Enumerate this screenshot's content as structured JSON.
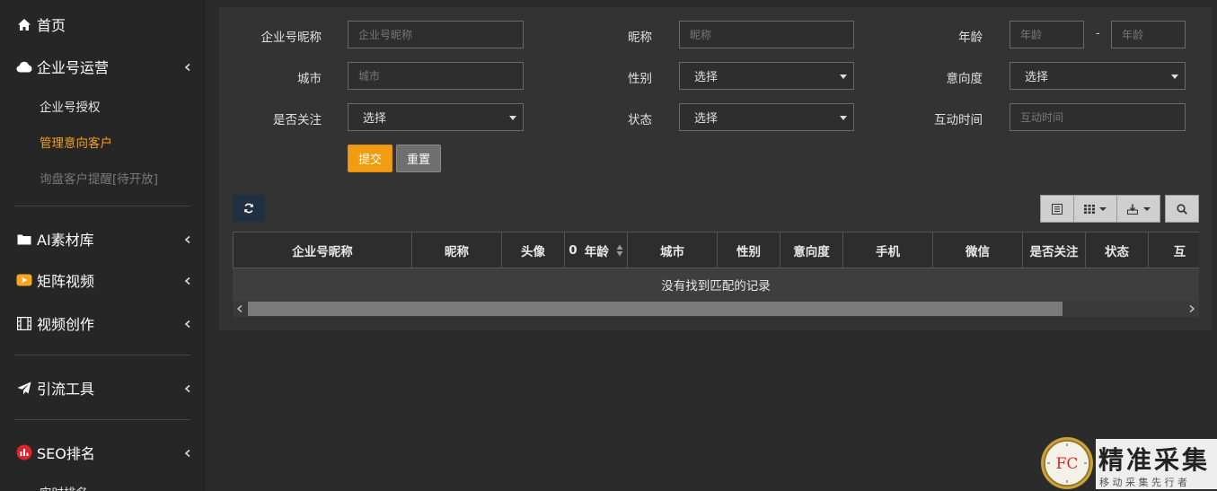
{
  "sidebar": {
    "home": "首页",
    "enterprise_ops": "企业号运营",
    "enterprise_sub": [
      "企业号授权",
      "管理意向客户",
      "询盘客户提醒[待开放]"
    ],
    "ai_library": "AI素材库",
    "matrix_video": "矩阵视频",
    "video_creation": "视频创作",
    "traffic_tools": "引流工具",
    "seo_rank": "SEO排名",
    "seo_sub_partial": "实时排名"
  },
  "filters": {
    "enterprise_nickname": {
      "label": "企业号昵称",
      "placeholder": "企业号昵称"
    },
    "nickname": {
      "label": "昵称",
      "placeholder": "昵称"
    },
    "age": {
      "label": "年龄",
      "placeholder_from": "年龄",
      "separator": "-",
      "placeholder_to": "年龄"
    },
    "city": {
      "label": "城市",
      "placeholder": "城市"
    },
    "gender": {
      "label": "性别",
      "value": "选择"
    },
    "intent": {
      "label": "意向度",
      "value": "选择"
    },
    "followed": {
      "label": "是否关注",
      "value": "选择"
    },
    "status": {
      "label": "状态",
      "value": "选择"
    },
    "interact_time": {
      "label": "互动时间",
      "placeholder": "互动时间"
    },
    "submit": "提交",
    "reset": "重置"
  },
  "table": {
    "columns": [
      "企业号昵称",
      "昵称",
      "头像",
      "年龄",
      "城市",
      "性别",
      "意向度",
      "手机",
      "微信",
      "是否关注",
      "状态",
      "互"
    ],
    "age_sort_prefix": "0",
    "empty_text": "没有找到匹配的记录",
    "scroll_fraction": 0.87
  },
  "logo": {
    "badge": "FC",
    "title": "精准采集",
    "subtitle": "移 动 采 集 先 行 者"
  },
  "colors": {
    "accent": "#f29c11",
    "active_menu": "#f0a020",
    "panel_bg": "#333333",
    "page_bg": "#2b2b2b"
  }
}
